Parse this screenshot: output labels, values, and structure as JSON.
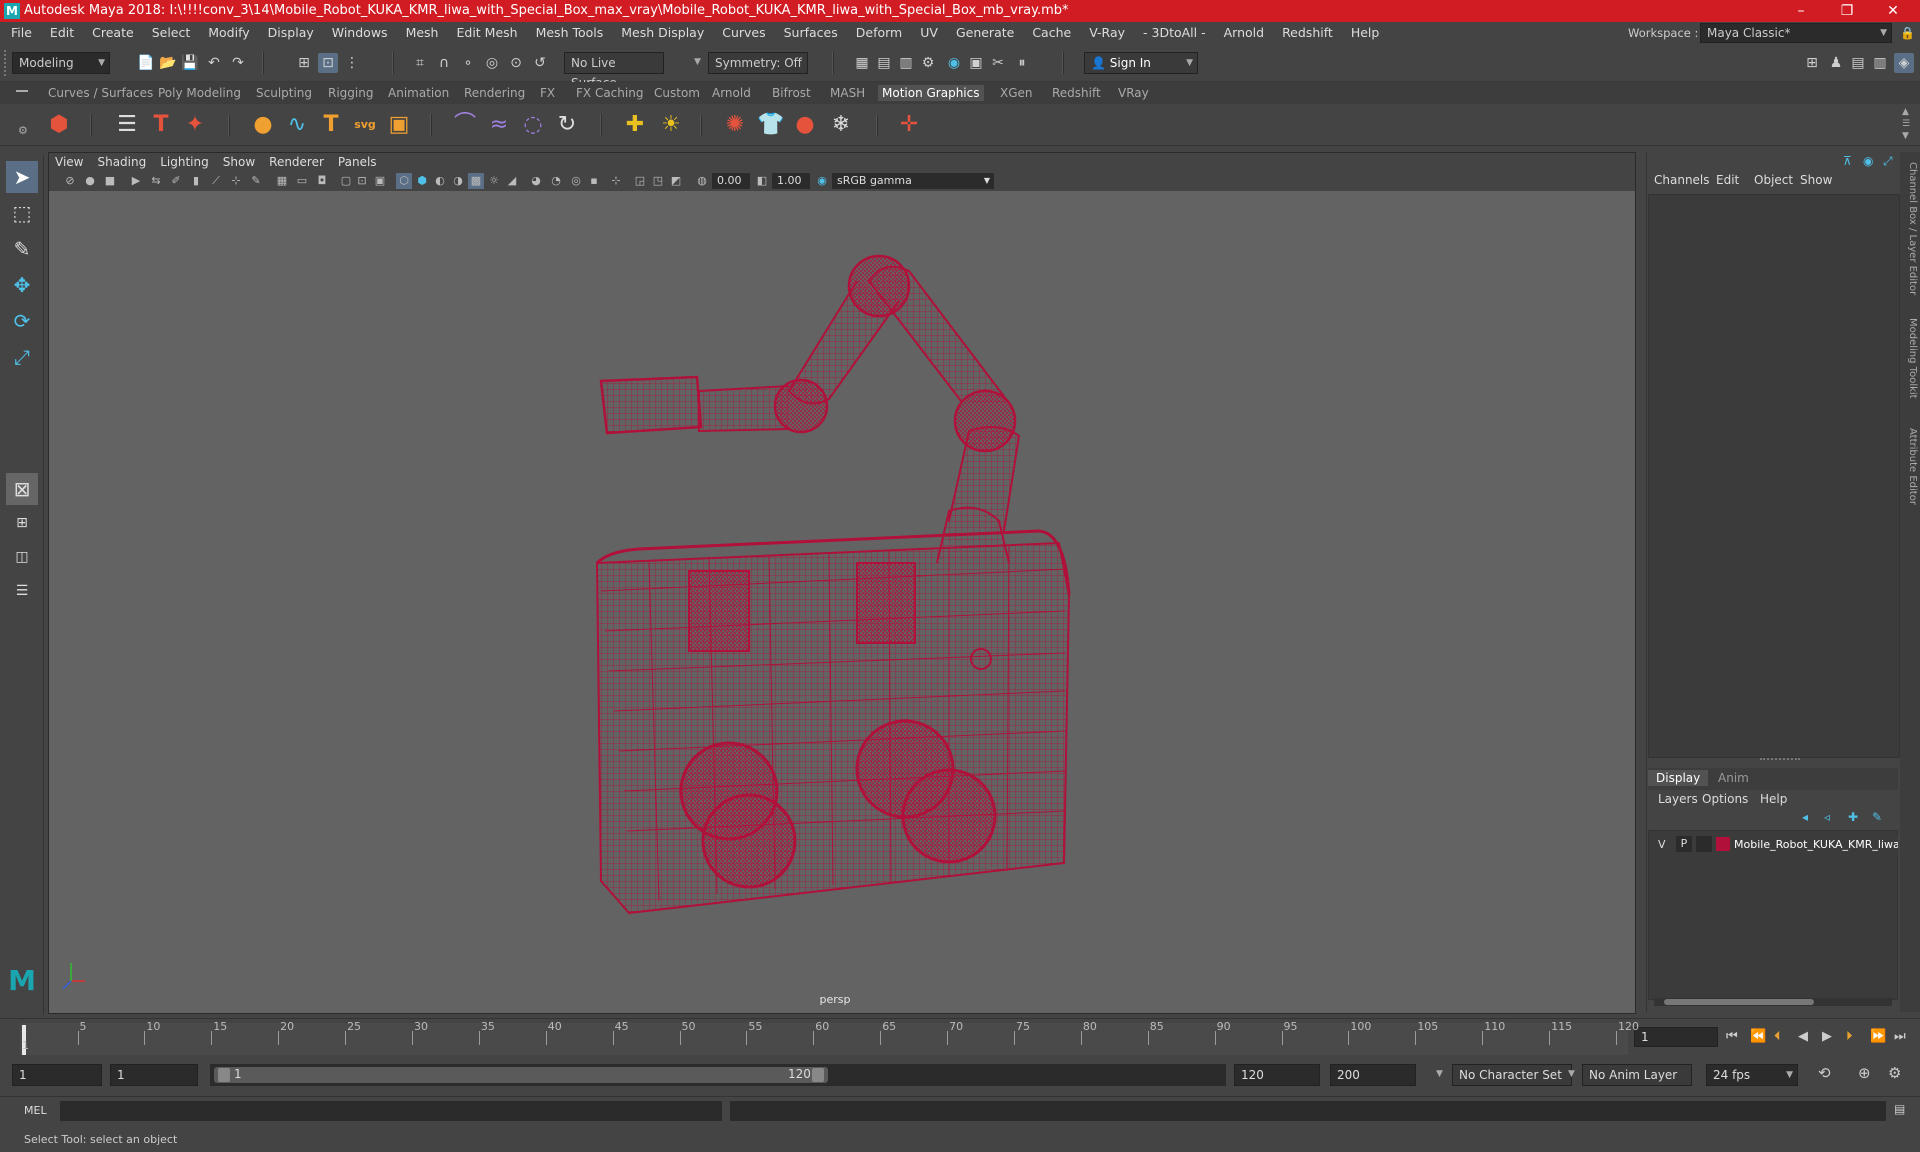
{
  "window": {
    "title": "Autodesk Maya 2018: I:\\!!!!conv_3\\14\\Mobile_Robot_KUKA_KMR_liwa_with_Special_Box_max_vray\\Mobile_Robot_KUKA_KMR_liwa_with_Special_Box_mb_vray.mb*",
    "app_icon": "M",
    "minimize": "–",
    "maximize": "❐",
    "close": "✕"
  },
  "menu": [
    "File",
    "Edit",
    "Create",
    "Select",
    "Modify",
    "Display",
    "Windows",
    "Mesh",
    "Edit Mesh",
    "Mesh Tools",
    "Mesh Display",
    "Curves",
    "Surfaces",
    "Deform",
    "UV",
    "Generate",
    "Cache",
    "V-Ray",
    "- 3DtoAll -",
    "Arnold",
    "Redshift",
    "Help"
  ],
  "workspace": {
    "label": "Workspace :",
    "value": "Maya Classic*"
  },
  "status": {
    "mode": "Modeling",
    "live_surface": "No Live Surface",
    "symmetry": "Symmetry: Off",
    "sign_in": "Sign In"
  },
  "shelf_tabs": [
    "Curves / Surfaces",
    "Poly Modeling",
    "Sculpting",
    "Rigging",
    "Animation",
    "Rendering",
    "FX",
    "FX Caching",
    "Custom",
    "Arnold",
    "Bifrost",
    "MASH",
    "Motion Graphics",
    "XGen",
    "Redshift",
    "VRay"
  ],
  "active_shelf_tab": "Motion Graphics",
  "viewport": {
    "menu": [
      "View",
      "Shading",
      "Lighting",
      "Show",
      "Renderer",
      "Panels"
    ],
    "exposure": "0.00",
    "gamma": "1.00",
    "color_space": "sRGB gamma",
    "camera": "persp",
    "wire_color": "#b0103a"
  },
  "channel_box": {
    "menu": [
      "Channels",
      "Edit",
      "Object",
      "Show"
    ],
    "side_tabs": [
      "Channel Box / Layer Editor",
      "Modeling Toolkit",
      "Attribute Editor"
    ]
  },
  "layer_editor": {
    "tabs": [
      "Display",
      "Anim"
    ],
    "menu": [
      "Layers",
      "Options",
      "Help"
    ],
    "layer": {
      "v": "V",
      "p": "P",
      "name": "Mobile_Robot_KUKA_KMR_liwa",
      "color": "#b0103a"
    }
  },
  "timeline": {
    "ticks": [
      "5",
      "10",
      "15",
      "20",
      "25",
      "30",
      "35",
      "40",
      "45",
      "50",
      "55",
      "60",
      "65",
      "70",
      "75",
      "80",
      "85",
      "90",
      "95",
      "100",
      "105",
      "110",
      "115",
      "120"
    ],
    "first_tick": "1",
    "current_frame": "1"
  },
  "range": {
    "start": "1",
    "playback_start": "1",
    "slider_start": "1",
    "slider_end": "120",
    "playback_end": "120",
    "end": "200",
    "character_set": "No Character Set",
    "anim_layer": "No Anim Layer",
    "fps": "24 fps"
  },
  "cmdline": {
    "label": "MEL"
  },
  "help": "Select Tool: select an object"
}
